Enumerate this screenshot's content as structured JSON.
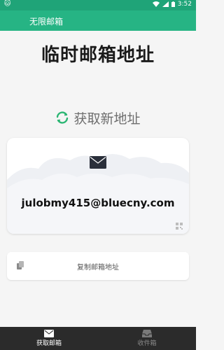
{
  "status_bar": {
    "left_text": "🐱",
    "time": "3:52"
  },
  "app_bar": {
    "title": "无限邮箱"
  },
  "main": {
    "title": "临时邮箱地址",
    "refresh_label": "获取新地址",
    "email_address": "julobmy415@bluecny.com",
    "copy_label": "复制邮箱地址"
  },
  "bottom_nav": {
    "items": [
      {
        "label": "获取邮箱",
        "icon": "envelope-icon",
        "active": true
      },
      {
        "label": "收件箱",
        "icon": "inbox-icon",
        "active": false
      }
    ]
  },
  "colors": {
    "accent": "#26b484",
    "status_bar": "#1fa478",
    "refresh_icon": "#2bb673",
    "nav_bg": "#2b2b2b"
  }
}
